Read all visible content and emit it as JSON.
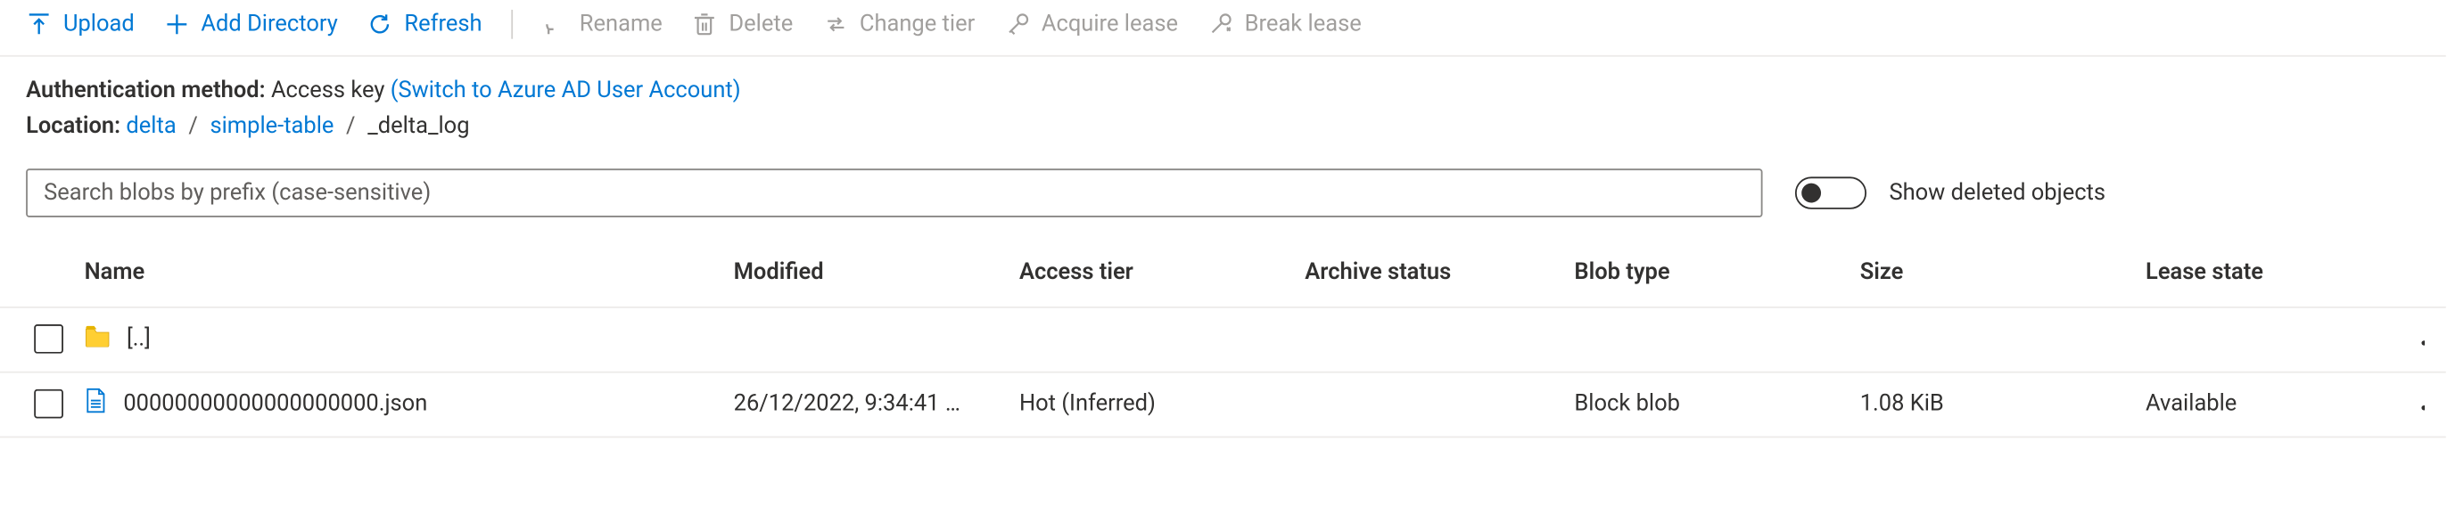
{
  "toolbar": {
    "upload": "Upload",
    "add_directory": "Add Directory",
    "refresh": "Refresh",
    "rename": "Rename",
    "delete": "Delete",
    "change_tier": "Change tier",
    "acquire_lease": "Acquire lease",
    "break_lease": "Break lease"
  },
  "auth": {
    "label": "Authentication method:",
    "value": "Access key",
    "switch": "(Switch to Azure AD User Account)"
  },
  "location": {
    "label": "Location:",
    "crumbs": [
      "delta",
      "simple-table"
    ],
    "current": "_delta_log"
  },
  "search": {
    "placeholder": "Search blobs by prefix (case-sensitive)",
    "toggle_label": "Show deleted objects"
  },
  "columns": {
    "name": "Name",
    "modified": "Modified",
    "access_tier": "Access tier",
    "archive_status": "Archive status",
    "blob_type": "Blob type",
    "size": "Size",
    "lease_state": "Lease state"
  },
  "rows": [
    {
      "type": "folder",
      "name": "[..]",
      "modified": "",
      "access_tier": "",
      "archive_status": "",
      "blob_type": "",
      "size": "",
      "lease_state": ""
    },
    {
      "type": "file",
      "name": "00000000000000000000.json",
      "modified": "26/12/2022, 9:34:41 …",
      "access_tier": "Hot (Inferred)",
      "archive_status": "",
      "blob_type": "Block blob",
      "size": "1.08 KiB",
      "lease_state": "Available"
    }
  ]
}
